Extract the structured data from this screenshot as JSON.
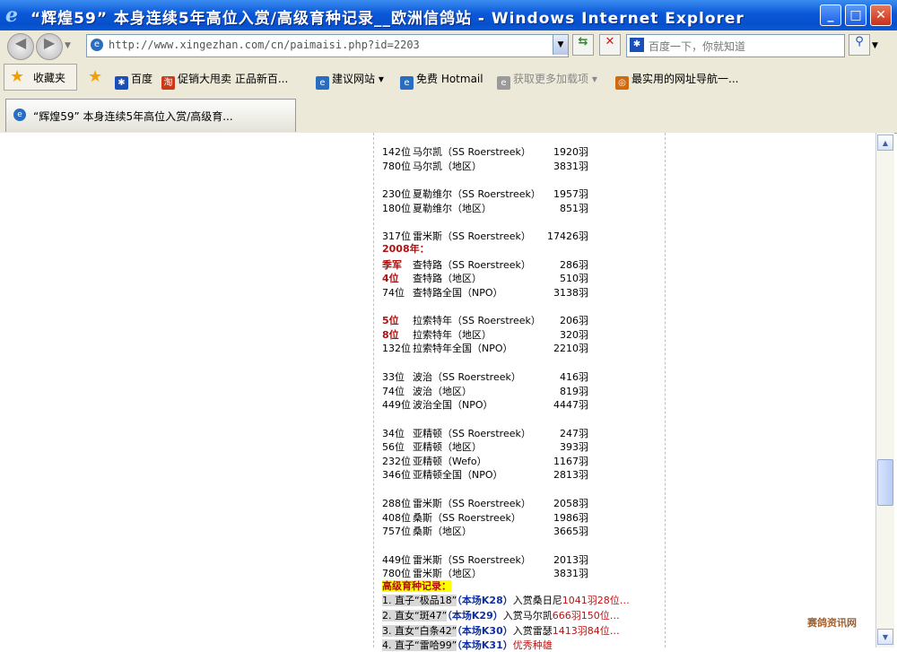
{
  "window": {
    "title": "“辉煌59” 本身连续5年高位入赏/高级育种记录__欧洲信鸽站 - Windows Internet Explorer"
  },
  "nav": {
    "address": "http://www.xingezhan.com/cn/paimaisi.php?id=2203",
    "search_placeholder": "百度一下，你就知道"
  },
  "favorites": {
    "label": "收藏夹",
    "items": [
      "百度",
      "促销大甩卖 正品新百...",
      "建议网站",
      "免费 Hotmail",
      "获取更多加载项",
      "最实用的网址导航一..."
    ]
  },
  "tab": {
    "label": "“辉煌59” 本身连续5年高位入赏/高级育..."
  },
  "records": [
    {
      "rank": "142位",
      "name": "马尔凯（SS Roerstreek）",
      "count": "1920羽"
    },
    {
      "rank": "780位",
      "name": "马尔凯（地区）",
      "count": "3831羽"
    },
    {
      "rank": "230位",
      "name": "夏勒维尔（SS Roerstreek）",
      "count": "1957羽"
    },
    {
      "rank": "180位",
      "name": "夏勒维尔（地区）",
      "count": "851羽"
    },
    {
      "rank": "317位",
      "name": "雷米斯（SS Roerstreek）",
      "count": "17426羽"
    },
    {
      "rank": "季军",
      "name": "查特路（SS Roerstreek）",
      "count": "286羽"
    },
    {
      "rank": "4位",
      "name": "查特路（地区）",
      "count": "510羽"
    },
    {
      "rank": "74位",
      "name": "查特路全国（NPO）",
      "count": "3138羽"
    },
    {
      "rank": "5位",
      "name": "拉索特年（SS Roerstreek）",
      "count": "206羽"
    },
    {
      "rank": "8位",
      "name": "拉索特年（地区）",
      "count": "320羽"
    },
    {
      "rank": "132位",
      "name": "拉索特年全国（NPO）",
      "count": "2210羽"
    },
    {
      "rank": "33位",
      "name": "波治（SS Roerstreek）",
      "count": "416羽"
    },
    {
      "rank": "74位",
      "name": "波治（地区）",
      "count": "819羽"
    },
    {
      "rank": "449位",
      "name": "波治全国（NPO）",
      "count": "4447羽"
    },
    {
      "rank": "34位",
      "name": "亚精顿（SS Roerstreek）",
      "count": "247羽"
    },
    {
      "rank": "56位",
      "name": "亚精顿（地区）",
      "count": "393羽"
    },
    {
      "rank": "232位",
      "name": "亚精顿（Wefo）",
      "count": "1167羽"
    },
    {
      "rank": "346位",
      "name": "亚精顿全国（NPO）",
      "count": "2813羽"
    },
    {
      "rank": "288位",
      "name": "雷米斯（SS Roerstreek）",
      "count": "2058羽"
    },
    {
      "rank": "408位",
      "name": "桑斯（SS Roerstreek）",
      "count": "1986羽"
    },
    {
      "rank": "757位",
      "name": "桑斯（地区）",
      "count": "3665羽"
    },
    {
      "rank": "449位",
      "name": "雷米斯（SS Roerstreek）",
      "count": "2013羽"
    },
    {
      "rank": "780位",
      "name": "雷米斯（地区）",
      "count": "3831羽"
    }
  ],
  "year_header": "2008年：",
  "breeding": {
    "title": "高级育种记录：",
    "lines": [
      {
        "a": "1. 直子“极品18”",
        "b": "（本场K28）",
        "c": "入赏桑日尼",
        "d": "1041羽28位…"
      },
      {
        "a": "2. 直女“斑47”",
        "b": "（本场K29）",
        "c": "入赏马尔凯",
        "d": "666羽150位…"
      },
      {
        "a": "3. 直女“白条42”",
        "b": "（本场K30）",
        "c": "入赏雷瑟",
        "d": "1413羽84位…"
      },
      {
        "a": "4. 直子“雷哈99”",
        "b": "（本场K31）",
        "c": "",
        "d": "优秀种雄"
      }
    ]
  },
  "watermark": "赛鸽资讯网"
}
